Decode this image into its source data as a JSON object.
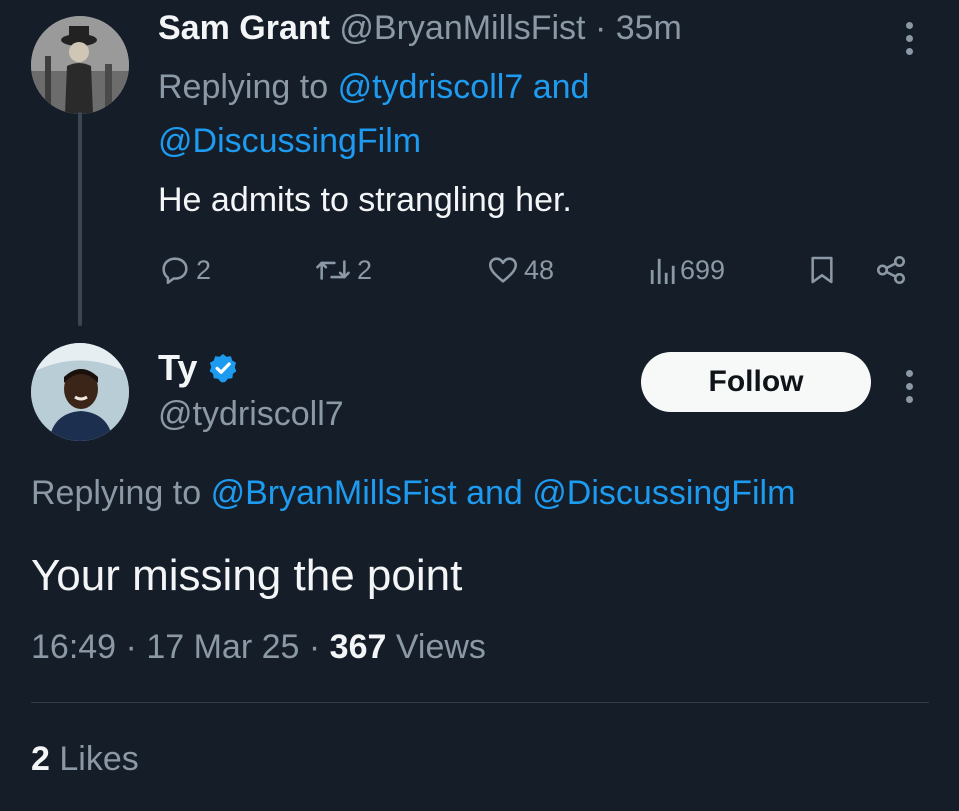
{
  "parent_tweet": {
    "author_name": "Sam Grant",
    "author_handle": "@BryanMillsFist",
    "separator": "·",
    "time_ago": "35m",
    "replying_prefix": "Replying to",
    "replying_user_1": "@tydriscoll7",
    "replying_and": "and",
    "replying_user_2": "@DiscussingFilm",
    "text": "He admits to strangling her.",
    "stats": {
      "replies": "2",
      "reposts": "2",
      "likes": "48",
      "views": "699"
    }
  },
  "main_tweet": {
    "author_name": "Ty",
    "author_handle": "@tydriscoll7",
    "follow_label": "Follow",
    "replying_prefix": "Replying to",
    "replying_user_1": "@BryanMillsFist",
    "replying_and": "and",
    "replying_user_2": "@DiscussingFilm",
    "text": "Your missing the point",
    "time": "16:49",
    "separator": "·",
    "date": "17 Mar 25",
    "views_count": "367",
    "views_label": "Views",
    "likes_count": "2",
    "likes_label": "Likes"
  },
  "icons": {
    "reply": "reply-icon",
    "repost": "repost-icon",
    "like": "heart-icon",
    "views": "views-bar-chart-icon",
    "bookmark": "bookmark-icon",
    "share": "share-icon",
    "more": "more-vertical-icon",
    "verified": "verified-badge-icon"
  },
  "colors": {
    "background": "#151d28",
    "link": "#1d9bf0",
    "muted": "#8b98a5",
    "text": "#f3f5f7",
    "verified": "#1d9bf0",
    "follow_bg": "#f7f9f9"
  }
}
